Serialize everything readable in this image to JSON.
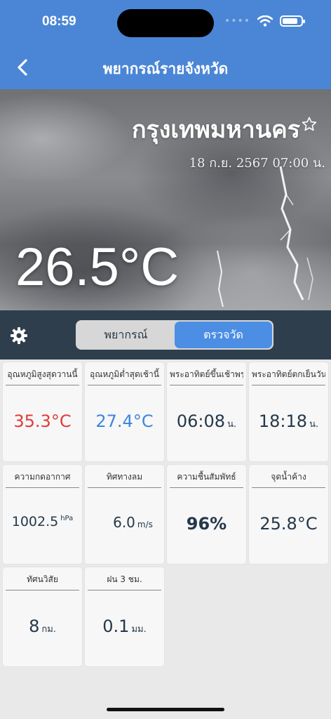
{
  "status": {
    "time": "08:59",
    "signal_icon": "cell-dots-icon",
    "wifi_icon": "wifi-icon",
    "battery_icon": "battery-icon",
    "battery_level": 0.85
  },
  "nav": {
    "title": "พยากรณ์รายจังหวัด",
    "back_icon": "chevron-left-icon"
  },
  "hero": {
    "city": "กรุงเทพมหานคร",
    "favorite_icon": "star-outline-icon",
    "datetime": "18 ก.ย. 2567 07:00 น.",
    "temperature": "26.5°C"
  },
  "controls": {
    "settings_icon": "gear-icon",
    "tabs": [
      {
        "label": "พยากรณ์",
        "active": false
      },
      {
        "label": "ตรวจวัด",
        "active": true
      }
    ]
  },
  "cards": [
    {
      "title": "อุณหภูมิสูงสุดวานนี้",
      "value": "35.3°C",
      "unit": "",
      "color": "#e23b3b"
    },
    {
      "title": "อุณหภูมิต่ำสุดเช้านี้",
      "value": "27.4°C",
      "unit": "",
      "color": "#3d86e0"
    },
    {
      "title": "พระอาทิตย์ขึ้นเช้าพรุ่งนี้",
      "value": "06:08",
      "unit": "น."
    },
    {
      "title": "พระอาทิตย์ตกเย็นวันนี้",
      "value": "18:18",
      "unit": "น."
    },
    {
      "title": "ความกดอากาศ",
      "value": "1002.5",
      "unit": "hPa"
    },
    {
      "title": "ทิศทางลม",
      "value": "6.0",
      "unit": "m/s"
    },
    {
      "title": "ความชื้นสัมพัทธ์",
      "value": "96%",
      "unit": ""
    },
    {
      "title": "จุดน้ำค้าง",
      "value": "25.8°C",
      "unit": ""
    },
    {
      "title": "ทัศนวิสัย",
      "value": "8",
      "unit": "กม."
    },
    {
      "title": "ฝน 3 ชม.",
      "value": "0.1",
      "unit": "มม."
    }
  ]
}
